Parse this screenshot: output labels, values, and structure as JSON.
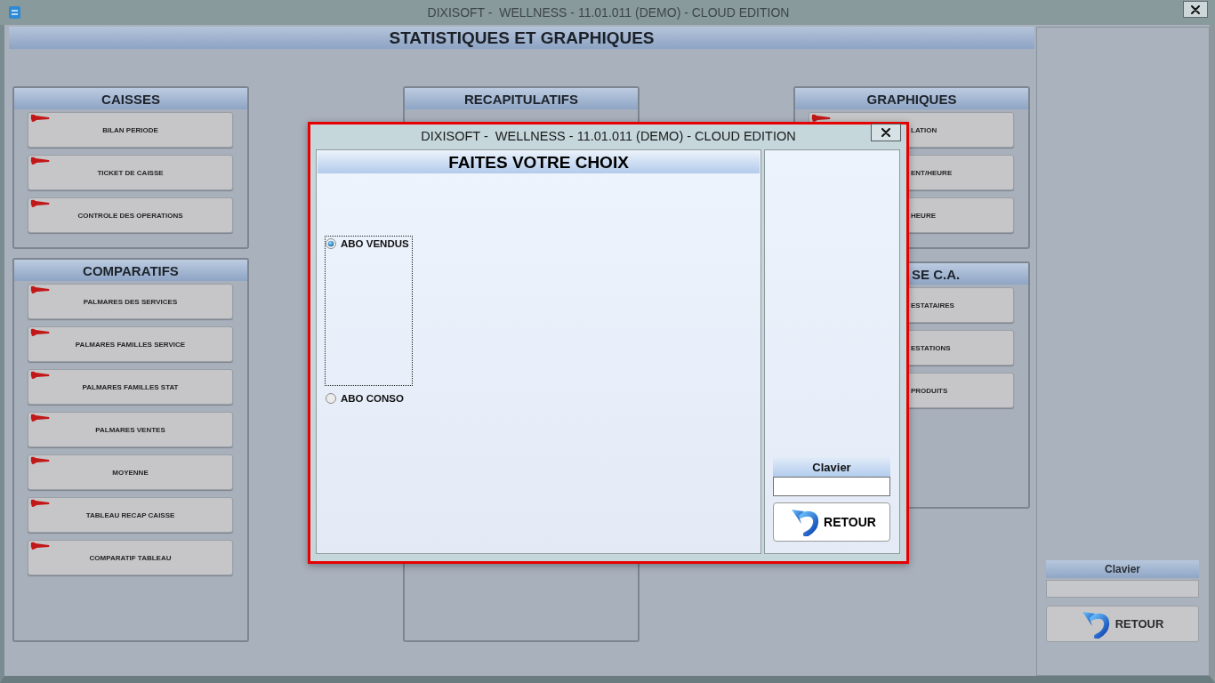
{
  "window": {
    "title": "DIXISOFT -  WELLNESS - 11.01.011 (DEMO) - CLOUD EDITION"
  },
  "page_title": "STATISTIQUES ET GRAPHIQUES",
  "columns": [
    {
      "panels": [
        {
          "title": "CAISSES",
          "buttons": [
            "BILAN PERIODE",
            "TICKET DE CAISSE",
            "CONTROLE DES OPERATIONS"
          ]
        },
        {
          "title": "COMPARATIFS",
          "buttons": [
            "PALMARES DES SERVICES",
            "PALMARES FAMILLES SERVICE",
            "PALMARES FAMILLES STAT",
            "PALMARES VENTES",
            "MOYENNE",
            "TABLEAU RECAP CAISSE",
            "COMPARATIF TABLEAU"
          ]
        }
      ]
    },
    {
      "panels": [
        {
          "title": "RECAPITULATIFS"
        }
      ]
    },
    {
      "panels": [
        {
          "title": "GRAPHIQUES",
          "buttons": [
            "LATION",
            "ENT/HEURE",
            "HEURE"
          ]
        },
        {
          "title": "SE C.A.",
          "buttons": [
            "ESTATAIRES",
            "ESTATIONS",
            "PRODUITS"
          ]
        }
      ]
    }
  ],
  "side_panel": {
    "keyboard_label": "Clavier",
    "back_button": "RETOUR"
  },
  "dialog": {
    "title": "DIXISOFT -  WELLNESS - 11.01.011 (DEMO) - CLOUD EDITION",
    "heading": "FAITES VOTRE CHOIX",
    "options": [
      {
        "label": "ABO VENDUS",
        "selected": true,
        "focused": true
      },
      {
        "label": "ABO CONSO",
        "selected": false,
        "focused": false
      }
    ],
    "keyboard_label": "Clavier",
    "back_button": "RETOUR"
  }
}
